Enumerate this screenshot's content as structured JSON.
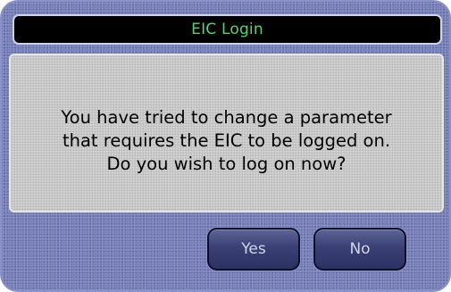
{
  "dialog": {
    "title": "EIC Login",
    "message_lines": [
      "You have tried to change a parameter",
      "that requires the EIC to be logged on.",
      "Do you wish to log on now?"
    ],
    "buttons": {
      "yes_label": "Yes",
      "no_label": "No"
    }
  },
  "colors": {
    "frame_blue": "#6f78b8",
    "title_bar_bg": "#000000",
    "title_text": "#5dcf6d",
    "panel_gray": "#c9c9c9",
    "button_bg": "#3a4074",
    "button_text": "#d2d5ea"
  }
}
